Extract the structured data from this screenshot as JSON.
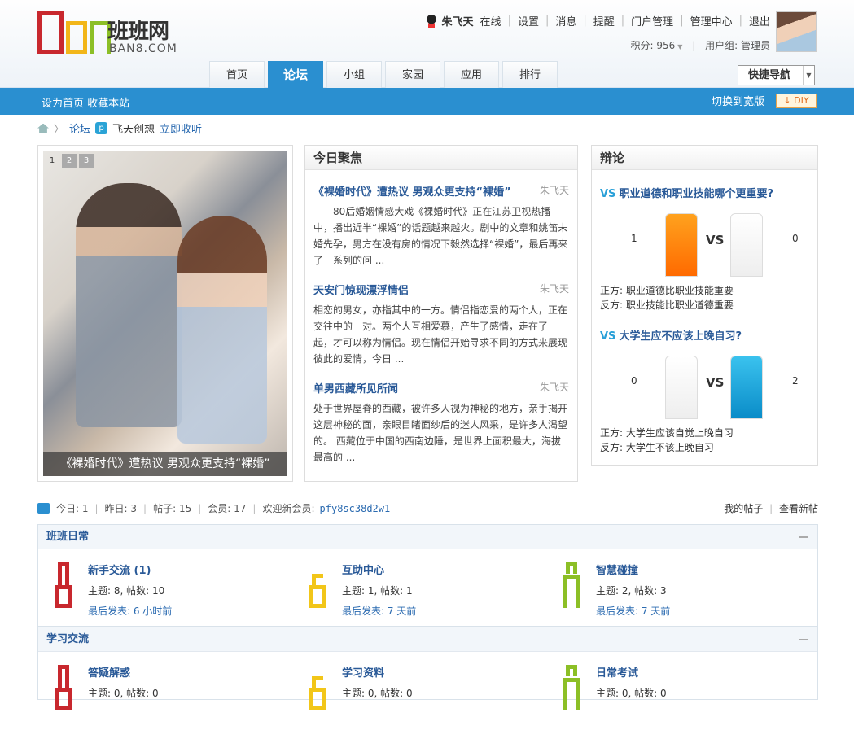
{
  "logo": {
    "cn": "班班网",
    "en": "BAN8.COM"
  },
  "user": {
    "name": "朱飞天",
    "status": "在线",
    "links": [
      "设置",
      "消息",
      "提醒",
      "门户管理",
      "管理中心",
      "退出"
    ],
    "points_label": "积分: 956",
    "group_label": "用户组: 管理员"
  },
  "nav": {
    "tabs": [
      "首页",
      "论坛",
      "小组",
      "家园",
      "应用",
      "排行"
    ],
    "active": "论坛",
    "quick_nav": "快捷导航"
  },
  "subbar": {
    "set_home": "设为首页",
    "bookmark": "收藏本站",
    "wide": "切换到宽版",
    "diy": "DIY"
  },
  "breadcrumb": {
    "forum": "论坛",
    "feed": "飞天创想",
    "subscribe": "立即收听"
  },
  "slide": {
    "pages": [
      "1",
      "2",
      "3"
    ],
    "caption": "《裸婚时代》遭热议 男观众更支持“裸婚”"
  },
  "focus": {
    "title": "今日聚焦",
    "articles": [
      {
        "title": "《裸婚时代》遭热议 男观众更支持“裸婚”",
        "author": "朱飞天",
        "body": "　　80后婚姻情感大戏《裸婚时代》正在江苏卫视热播中，播出近半“裸婚”的话题越来越火。剧中的文章和姚笛未婚先孕，男方在没有房的情况下毅然选择“裸婚”，最后再来了一系列的问 ..."
      },
      {
        "title": "天安门惊现漂浮情侣",
        "author": "朱飞天",
        "body": "相恋的男女，亦指其中的一方。情侣指恋爱的两个人，正在交往中的一对。两个人互相爱慕，产生了感情，走在了一起，才可以称为情侣。现在情侣开始寻求不同的方式来展现彼此的爱情，今日 ..."
      },
      {
        "title": "单男西藏所见所闻",
        "author": "朱飞天",
        "body": "处于世界屋脊的西藏，被许多人视为神秘的地方，亲手揭开这层神秘的面，亲眼目睹面纱后的迷人风采，是许多人渴望的。 西藏位于中国的西南边陲，是世界上面积最大，海拔最高的 ..."
      }
    ]
  },
  "debate": {
    "title": "辩论",
    "items": [
      {
        "vs_tag": "VS",
        "question": "职业道德和职业技能哪个更重要?",
        "left": "1",
        "right": "0",
        "left_fill": 1.0,
        "right_fill": 0.0,
        "vs": "VS",
        "pro": "正方: 职业道德比职业技能重要",
        "con": "反方: 职业技能比职业道德重要"
      },
      {
        "vs_tag": "VS",
        "question": "大学生应不应该上晚自习?",
        "left": "0",
        "right": "2",
        "left_fill": 0.0,
        "right_fill": 1.0,
        "vs": "VS",
        "pro": "正方: 大学生应该自觉上晚自习",
        "con": "反方: 大学生不该上晚自习"
      }
    ]
  },
  "stats": {
    "today": "今日: 1",
    "yesterday": "昨日: 3",
    "posts": "帖子: 15",
    "members": "会员: 17",
    "welcome": "欢迎新会员:",
    "new_member": "pfy8sc38d2w1",
    "my_posts": "我的帖子",
    "new_posts": "查看新帖"
  },
  "sections": [
    {
      "title": "班班日常",
      "forums": [
        {
          "name": "新手交流 (1)",
          "stat": "主题: 8, 帖数: 10",
          "last": "最后发表: 6 小时前",
          "color": "#c8282e"
        },
        {
          "name": "互助中心",
          "stat": "主题: 1, 帖数: 1",
          "last": "最后发表: 7 天前",
          "color": "#f2c619"
        },
        {
          "name": "智慧碰撞",
          "stat": "主题: 2, 帖数: 3",
          "last": "最后发表: 7 天前",
          "color": "#8cbf26"
        }
      ]
    },
    {
      "title": "学习交流",
      "forums": [
        {
          "name": "答疑解惑",
          "stat": "主题: 0, 帖数: 0",
          "color": "#c8282e"
        },
        {
          "name": "学习资料",
          "stat": "主题: 0, 帖数: 0",
          "color": "#f2c619"
        },
        {
          "name": "日常考试",
          "stat": "主题: 0, 帖数: 0",
          "color": "#8cbf26"
        }
      ]
    }
  ],
  "colors": {
    "primary": "#2a8fd0",
    "link": "#2a5a98",
    "orange": "#ff7800",
    "blue_bar": "#1aa0d8"
  }
}
